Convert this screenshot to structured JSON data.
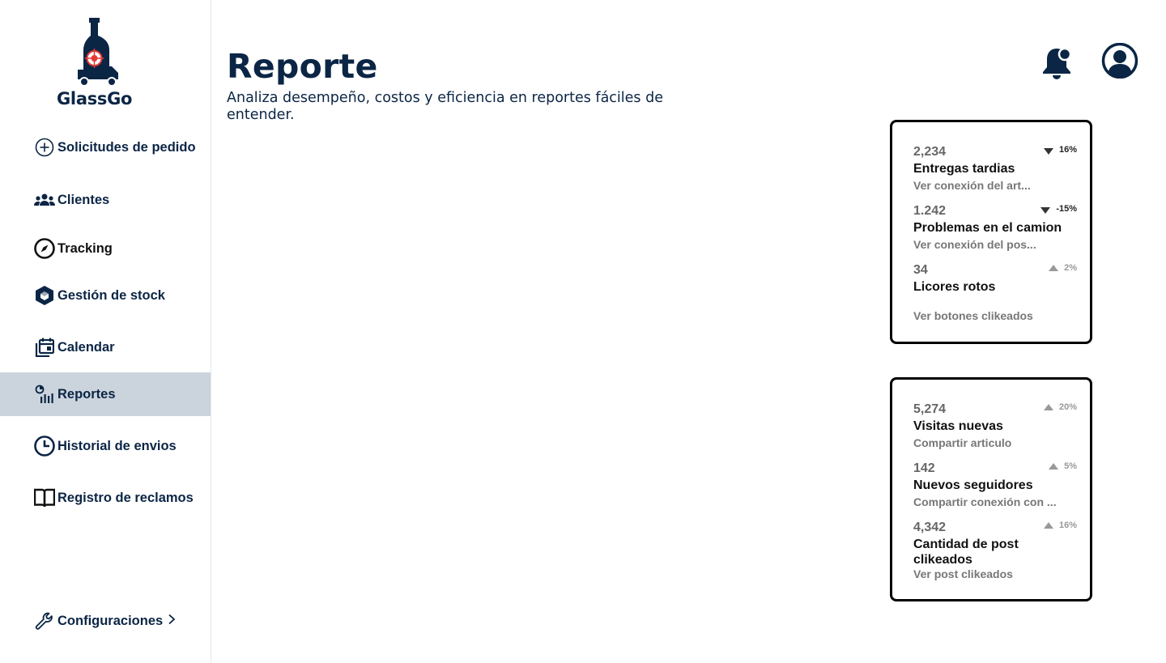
{
  "app": {
    "brand": "GlassGo"
  },
  "sidebar": {
    "items": [
      {
        "label": "Solicitudes de pedido",
        "icon": "plus-circle-icon"
      },
      {
        "label": "Clientes",
        "icon": "users-icon"
      },
      {
        "label": "Tracking",
        "icon": "compass-icon"
      },
      {
        "label": "Gestión de stock",
        "icon": "box-icon"
      },
      {
        "label": "Calendar",
        "icon": "calendar-icon"
      },
      {
        "label": "Reportes",
        "icon": "report-chart-icon",
        "active": true
      },
      {
        "label": "Historial de envios",
        "icon": "clock-icon"
      },
      {
        "label": "Registro de reclamos",
        "icon": "book-icon"
      }
    ],
    "settings": {
      "label": "Configuraciones",
      "icon": "wrench-icon"
    }
  },
  "header": {
    "title": "Reporte",
    "subtitle": "Analiza desempeño, costos y eficiencia en reportes fáciles de entender."
  },
  "cards": [
    {
      "stats": [
        {
          "value": "2,234",
          "title": "Entregas tardias",
          "link": "Ver conexión del art...",
          "trend": "16%",
          "direction": "down"
        },
        {
          "value": "1.242",
          "title": "Problemas en el camion",
          "link": "Ver conexión del pos...",
          "trend": "-15%",
          "direction": "down"
        },
        {
          "value": "34",
          "title": "Licores rotos",
          "link": "Ver botones clikeados",
          "trend": "2%",
          "direction": "up"
        }
      ]
    },
    {
      "stats": [
        {
          "value": "5,274",
          "title": "Visitas nuevas",
          "link": "Compartir articulo",
          "trend": "20%",
          "direction": "up"
        },
        {
          "value": "142",
          "title": "Nuevos seguidores",
          "link": "Compartir conexión con ...",
          "trend": "5%",
          "direction": "up"
        },
        {
          "value": "4,342",
          "title": "Cantidad de post clikeados",
          "link": "Ver post clikeados",
          "trend": "16%",
          "direction": "up"
        }
      ]
    }
  ],
  "colors": {
    "primary": "#0b2545",
    "active_bg": "#cbd4dd",
    "logo_accent": "#e53935"
  }
}
